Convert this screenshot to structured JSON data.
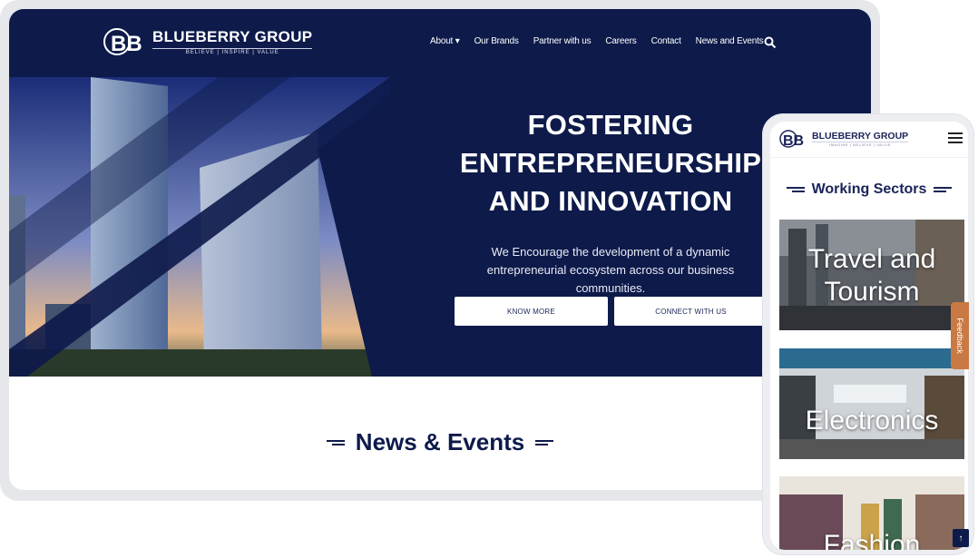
{
  "desktop": {
    "logo": {
      "name": "BLUEBERRY GROUP",
      "tagline": "BELIEVE | INSPIRE | VALUE",
      "mark": "BB"
    },
    "nav": {
      "items": [
        "About",
        "Our Brands",
        "Partner with us",
        "Careers",
        "Contact",
        "News and Events"
      ],
      "about_has_dropdown": true,
      "search_icon": "search-icon"
    },
    "hero": {
      "title_lines": [
        "FOSTERING",
        "ENTREPRENEURSHIP",
        "AND INNOVATION"
      ],
      "subtitle": "We Encourage the development of a dynamic entrepreneurial ecosystem across our business communities.",
      "buttons": {
        "know_more": "KNOW MORE",
        "connect": "CONNECT WITH US"
      }
    },
    "news": {
      "heading": "News & Events"
    }
  },
  "mobile": {
    "logo": {
      "name": "BLUEBERRY GROUP",
      "tagline": "IMAGINE | BELIEVE | VALUE",
      "mark": "BB"
    },
    "menu_icon": "hamburger-menu-icon",
    "sectors_heading": "Working Sectors",
    "cards": [
      {
        "label_lines": [
          "Travel and",
          "Tourism"
        ]
      },
      {
        "label_lines": [
          "Electronics"
        ]
      },
      {
        "label_lines": [
          "Fashion"
        ]
      }
    ],
    "feedback_tab": "Feedback",
    "scroll_top": "↑"
  },
  "colors": {
    "navy": "#0d1a4a",
    "accent": "#c97a44",
    "white": "#ffffff"
  }
}
